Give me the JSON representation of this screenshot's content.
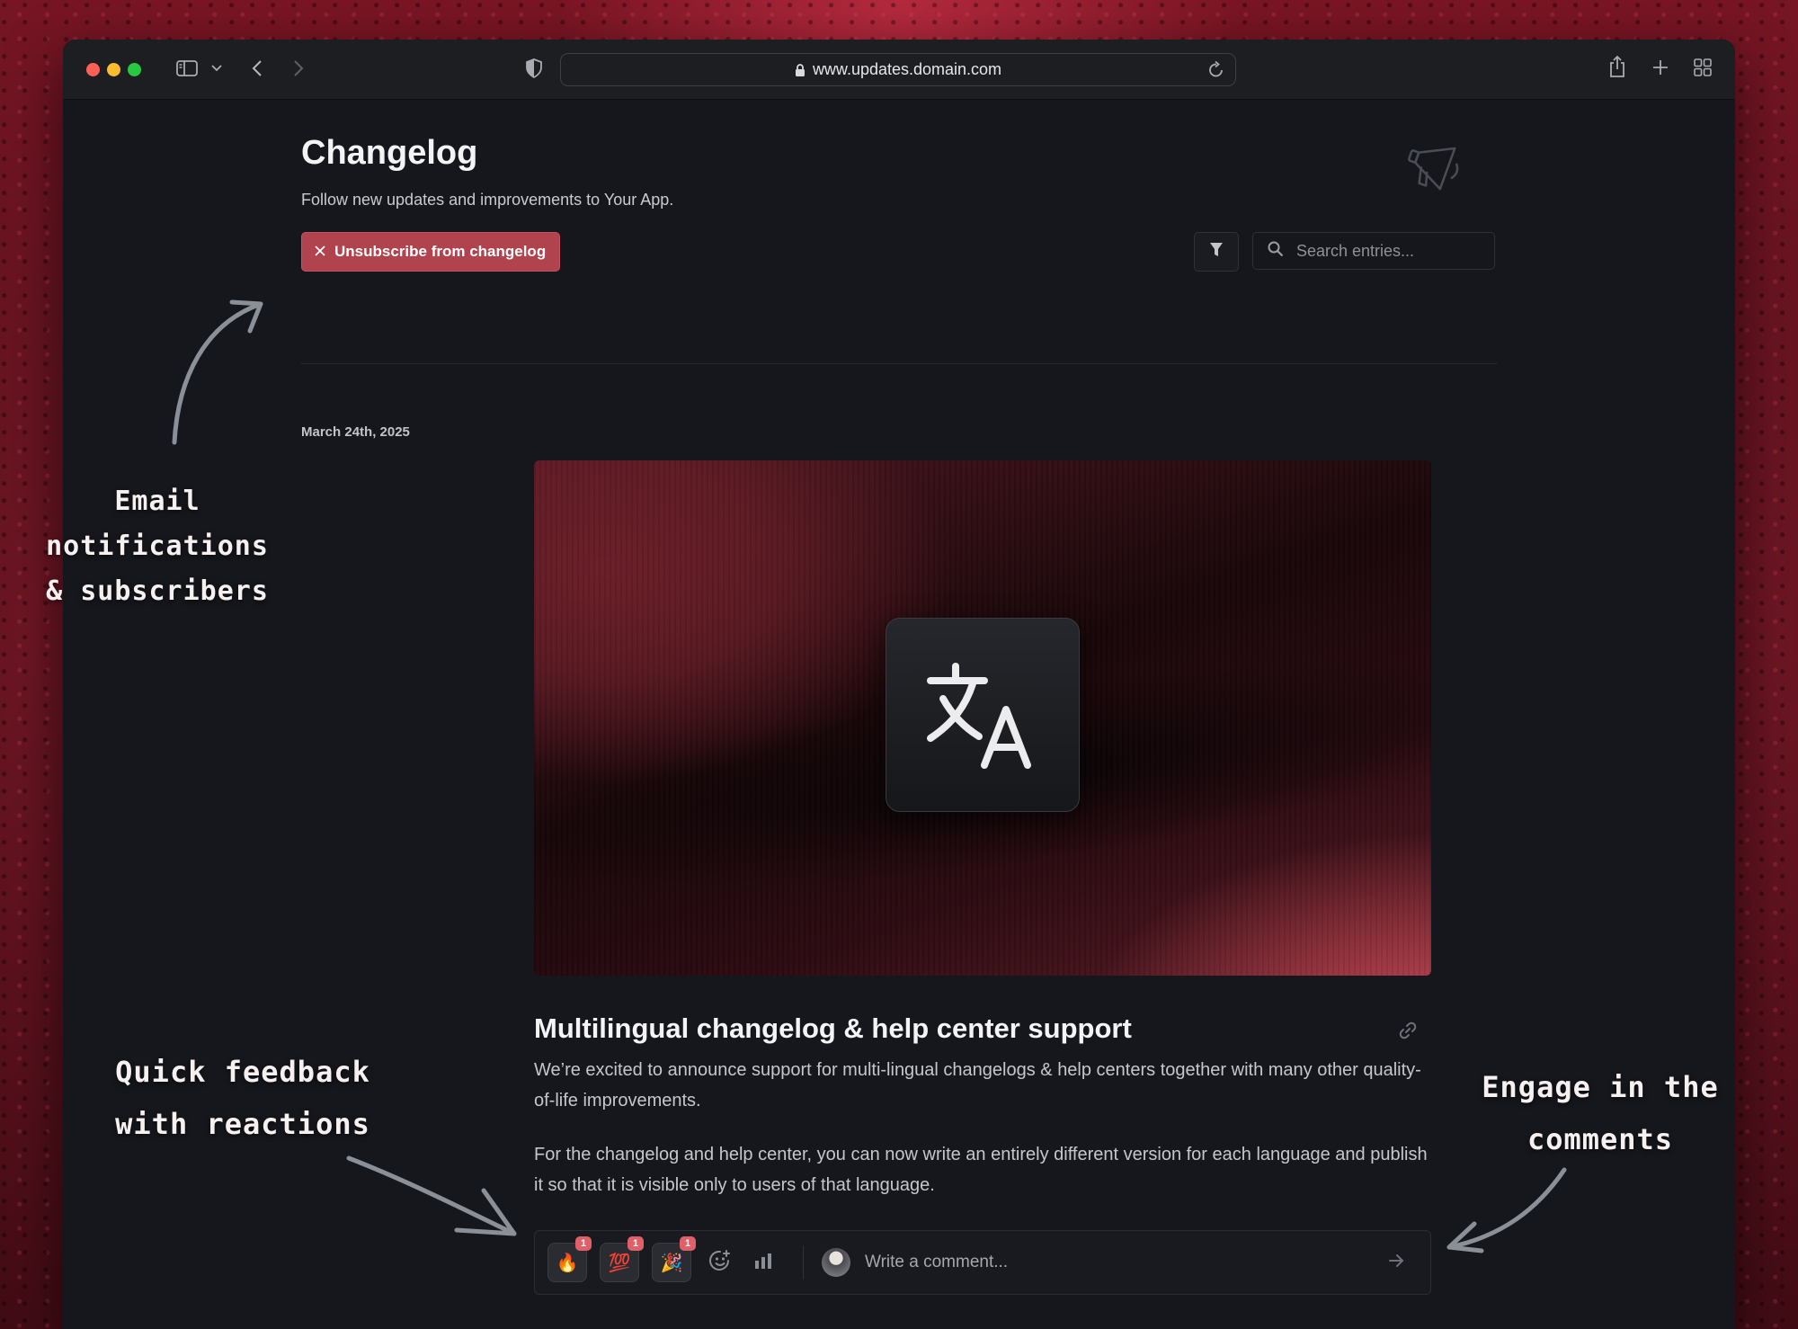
{
  "browser": {
    "url": "www.updates.domain.com"
  },
  "page": {
    "title": "Changelog",
    "subtitle": "Follow new updates and improvements to Your App.",
    "unsubscribe_label": "Unsubscribe from changelog",
    "search_placeholder": "Search entries..."
  },
  "entry": {
    "date": "March 24th, 2025",
    "title": "Multilingual changelog & help center support",
    "paragraphs": [
      "We’re excited to announce support for multi-lingual changelogs & help centers together with many other quality-of-life improvements.",
      "For the changelog and help center, you can now write an entirely different version for each language and publish it so that it is visible only to users of that language."
    ],
    "reactions": [
      {
        "emoji": "🔥",
        "count": "1",
        "icon": "fire-icon"
      },
      {
        "emoji": "💯",
        "count": "1",
        "icon": "hundred-icon"
      },
      {
        "emoji": "🎉",
        "count": "1",
        "icon": "party-popper-icon"
      }
    ],
    "comment_placeholder": "Write a comment..."
  },
  "annotations": {
    "email": [
      "Email notifications",
      "& subscribers"
    ],
    "reactions": [
      "Quick feedback",
      "with reactions"
    ],
    "comments": [
      "Engage in the",
      "comments"
    ]
  },
  "colors": {
    "accent": "#b0434d",
    "background": "#15171c",
    "badge": "#e0606a"
  }
}
